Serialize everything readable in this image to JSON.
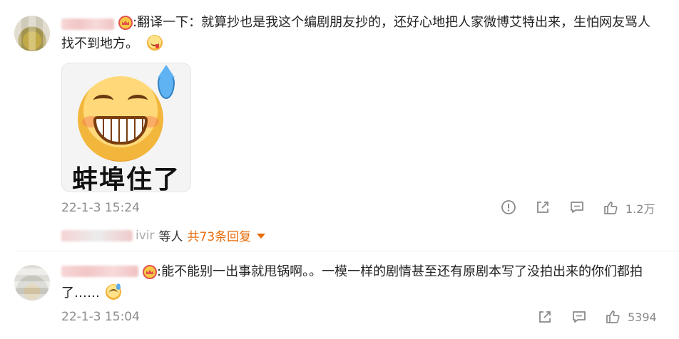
{
  "comments": [
    {
      "text": "翻译一下：就算抄也是我这个编剧朋友抄的，还好心地把人家微博艾特出来，生怕网友骂人找不到地方。",
      "text_line1": ":翻译一下：就算抄也是我这个编剧朋友抄的，还好心地把人家微博艾特出来，生怕网友骂人",
      "text_line2": "找不到地方。",
      "sticker_text": "蚌埠住了",
      "timestamp": "22-1-3 15:24",
      "likes": "1.2万",
      "replies": {
        "partial_name": "ivir",
        "suffix": "等人",
        "count_label": "共73条回复"
      }
    },
    {
      "text_line1": ":能不能别一出事就甩锅啊。。一模一样的剧情甚至还有原剧本写了没拍出来的你们都拍",
      "text_line2": "了……",
      "timestamp": "22-1-3 15:04",
      "likes": "5394"
    }
  ],
  "icons": {
    "report": "report-icon",
    "share": "share-icon",
    "comment": "comment-icon",
    "like": "thumbs-up-icon"
  },
  "colors": {
    "accent": "#e86b0a",
    "muted": "#8c8c8c"
  }
}
